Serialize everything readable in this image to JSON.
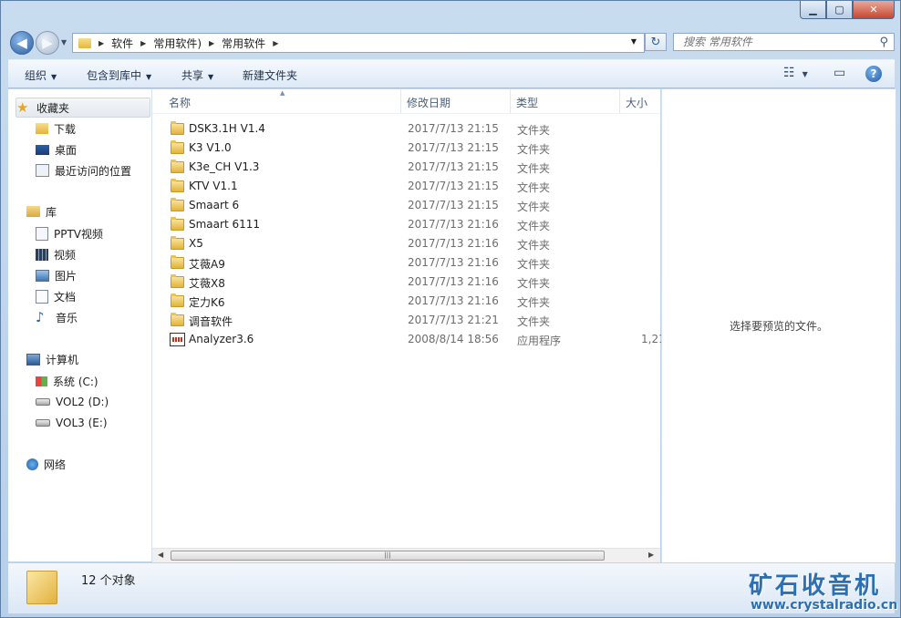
{
  "window": {
    "minimize_glyph": "▁",
    "maximize_glyph": "▢",
    "close_glyph": "✕"
  },
  "address": {
    "breadcrumbs": [
      "软件",
      "常用软件)",
      "常用软件"
    ],
    "search_placeholder": "搜索 常用软件"
  },
  "toolbar": {
    "organize": "组织",
    "include_in_library": "包含到库中",
    "share": "共享",
    "new_folder": "新建文件夹"
  },
  "nav": {
    "favorites": "收藏夹",
    "downloads": "下载",
    "desktop": "桌面",
    "recent": "最近访问的位置",
    "libraries": "库",
    "pptv": "PPTV视频",
    "videos": "视频",
    "pictures": "图片",
    "documents": "文档",
    "music": "音乐",
    "computer": "计算机",
    "drive_c": "系统 (C:)",
    "drive_d": "VOL2 (D:)",
    "drive_e": "VOL3 (E:)",
    "network": "网络"
  },
  "columns": {
    "name": "名称",
    "date": "修改日期",
    "type": "类型",
    "size": "大小"
  },
  "files": [
    {
      "name": "DSK3.1H V1.4",
      "date": "2017/7/13 21:15",
      "type": "文件夹",
      "size": ""
    },
    {
      "name": "K3 V1.0",
      "date": "2017/7/13 21:15",
      "type": "文件夹",
      "size": ""
    },
    {
      "name": "K3e_CH V1.3",
      "date": "2017/7/13 21:15",
      "type": "文件夹",
      "size": ""
    },
    {
      "name": "KTV V1.1",
      "date": "2017/7/13 21:15",
      "type": "文件夹",
      "size": ""
    },
    {
      "name": "Smaart 6",
      "date": "2017/7/13 21:15",
      "type": "文件夹",
      "size": ""
    },
    {
      "name": "Smaart 6111",
      "date": "2017/7/13 21:16",
      "type": "文件夹",
      "size": ""
    },
    {
      "name": "X5",
      "date": "2017/7/13 21:16",
      "type": "文件夹",
      "size": ""
    },
    {
      "name": "艾薇A9",
      "date": "2017/7/13 21:16",
      "type": "文件夹",
      "size": ""
    },
    {
      "name": "艾薇X8",
      "date": "2017/7/13 21:16",
      "type": "文件夹",
      "size": ""
    },
    {
      "name": "定力K6",
      "date": "2017/7/13 21:16",
      "type": "文件夹",
      "size": ""
    },
    {
      "name": "调音软件",
      "date": "2017/7/13 21:21",
      "type": "文件夹",
      "size": ""
    },
    {
      "name": "Analyzer3.6",
      "date": "2008/8/14 18:56",
      "type": "应用程序",
      "size": "1,21"
    }
  ],
  "preview": {
    "text": "选择要预览的文件。"
  },
  "details": {
    "count": "12 个对象"
  },
  "watermark": {
    "title": "矿石收音机",
    "url": "www.crystalradio.cn"
  }
}
